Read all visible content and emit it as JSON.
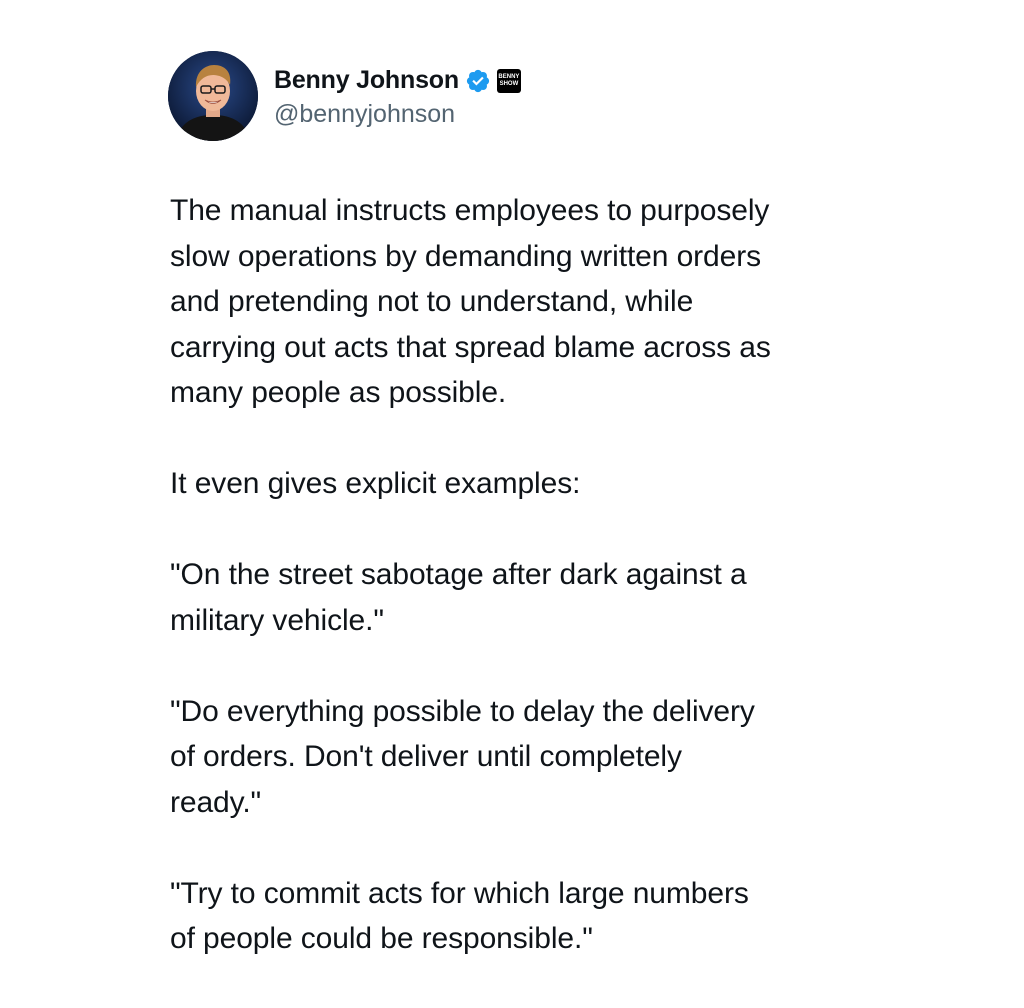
{
  "author": {
    "display_name": "Benny Johnson",
    "handle": "@bennyjohnson",
    "verified_color": "#1d9bf0",
    "affiliate_badge_text": "BENNY SHOW"
  },
  "tweet": {
    "paragraphs": [
      "The manual instructs employees to purposely\nslow operations by demanding written orders\nand pretending not to understand, while\ncarrying out acts that spread blame across as\nmany people as possible.",
      "It even gives explicit examples:",
      "\"On the street sabotage after dark against a\nmilitary vehicle.\"",
      "\"Do everything possible to delay the delivery\nof orders. Don't deliver until completely\nready.\"",
      "\"Try to commit acts for which large numbers\nof people could be responsible.\""
    ]
  }
}
